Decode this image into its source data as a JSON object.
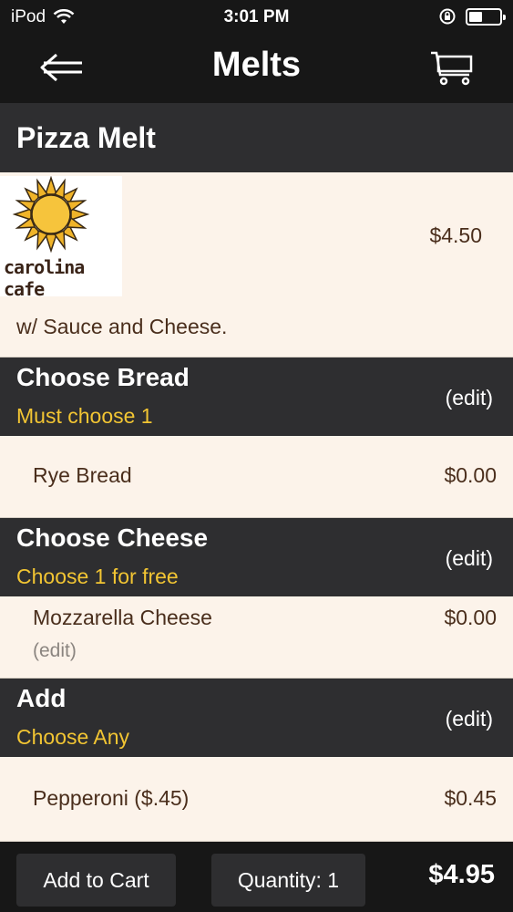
{
  "status_bar": {
    "carrier": "iPod",
    "time": "3:01 PM"
  },
  "nav": {
    "title": "Melts",
    "back_icon": "back-arrow-icon",
    "cart_icon": "cart-icon"
  },
  "item": {
    "name": "Pizza Melt",
    "logo_text": "carolina cafe",
    "price": "$4.50",
    "description": "w/ Sauce and Cheese."
  },
  "groups": [
    {
      "title": "Choose Bread",
      "subtitle": "Must choose 1",
      "edit": "(edit)",
      "options": [
        {
          "name": "Rye Bread",
          "price": "$0.00"
        }
      ]
    },
    {
      "title": "Choose Cheese",
      "subtitle": "Choose 1 for free",
      "edit": "(edit)",
      "options": [
        {
          "name": "Mozzarella Cheese",
          "price": "$0.00",
          "edit": "(edit)"
        }
      ]
    },
    {
      "title": "Add",
      "subtitle": "Choose Any",
      "edit": "(edit)",
      "options": [
        {
          "name": "Pepperoni ($.45)",
          "price": "$0.45"
        }
      ]
    }
  ],
  "bottom_bar": {
    "add_to_cart": "Add to Cart",
    "quantity": "Quantity: 1",
    "total": "$4.95"
  },
  "colors": {
    "bar_dark": "#171717",
    "header_gray": "#2e2e30",
    "content_bg": "#fcf3ea",
    "accent_yellow": "#f2c533",
    "text_brown": "#4a2e1c"
  }
}
